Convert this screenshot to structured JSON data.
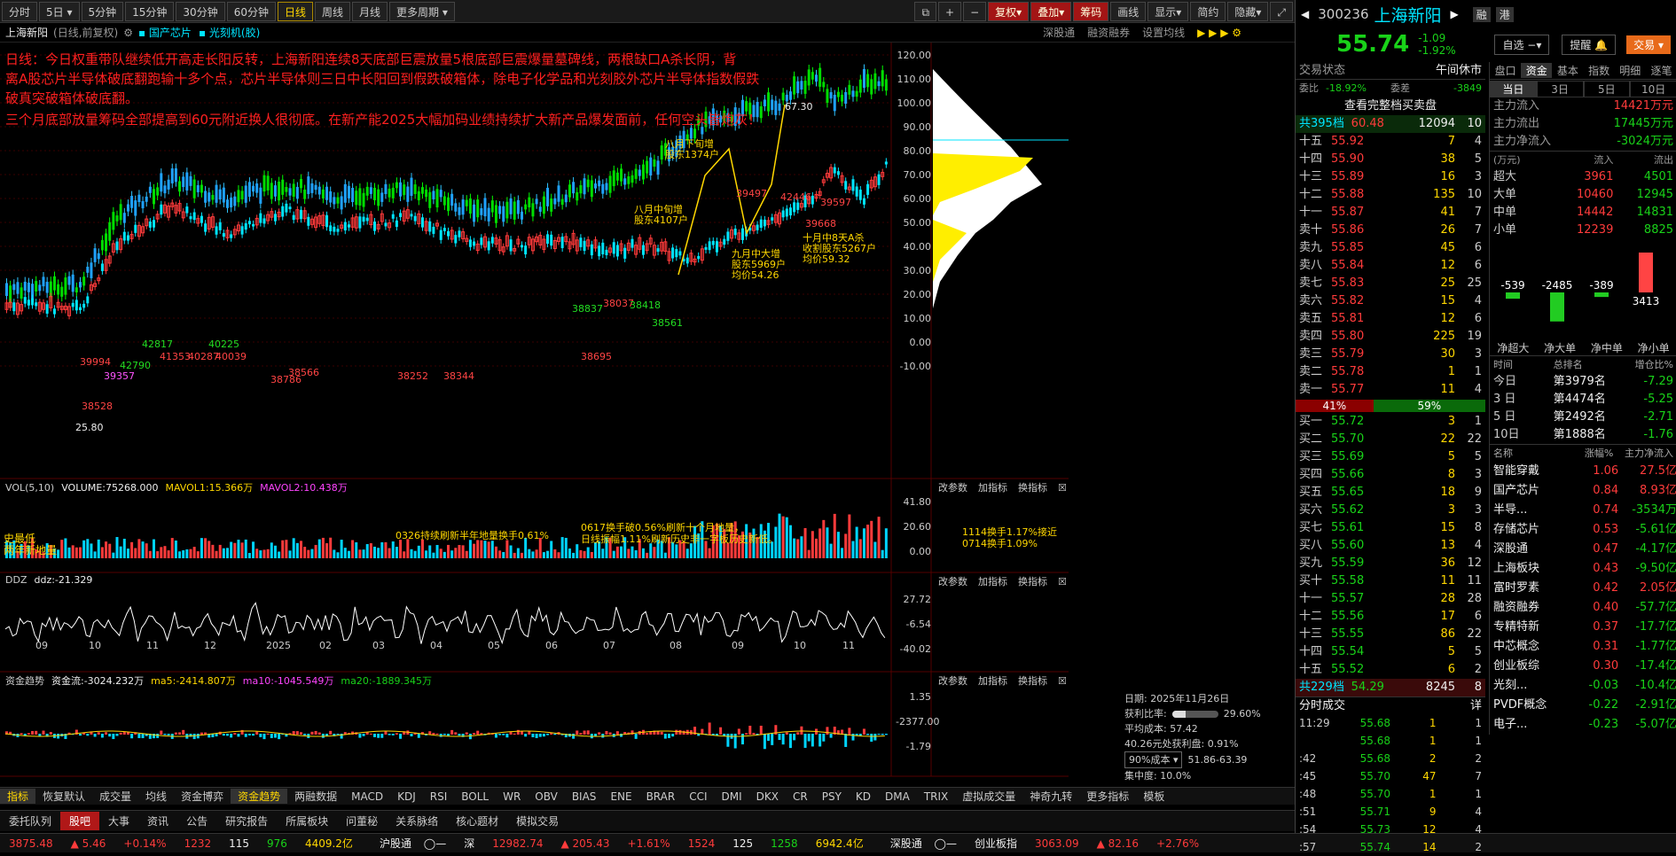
{
  "toolbar": {
    "items": [
      "分时",
      "5日",
      "5分钟",
      "15分钟",
      "30分钟",
      "60分钟",
      "日线",
      "周线",
      "月线",
      "更多周期"
    ],
    "active": "日线",
    "right": [
      "复权",
      "叠加",
      "筹码",
      "画线",
      "显示",
      "简约",
      "隐藏"
    ]
  },
  "subbar": {
    "title": "上海新阳",
    "mode": "(日线,前复权)",
    "concepts": [
      "国产芯片",
      "光刻机(胶)"
    ],
    "links": [
      "深股通",
      "融资融券",
      "设置均线"
    ]
  },
  "annotation_lines": [
    "日线：今日权重带队继续低开高走长阳反转，上海新阳连续8天底部巨震放量5根底部巨震爆量墓碑线，两根缺口A杀长阴，背",
    "离A股芯片半导体破底翻跑输十多个点，芯片半导体则三日中长阳回到假跌破箱体，除电子化学品和光刻胶外芯片半导体指数假跌",
    "破真突破箱体破底翻。",
    "三个月底部放量筹码全部提高到60元附近换人很彻底。在新产能2025大幅加码业绩持续扩大新产品爆发面前，任何空头皆炮灰！"
  ],
  "price_axis": [
    "120.00",
    "110.00",
    "100.00",
    "90.00",
    "80.00",
    "70.00",
    "60.00",
    "50.00",
    "40.00",
    "30.00",
    "20.00",
    "10.00",
    "0.00",
    "-10.00"
  ],
  "x_axis": [
    "09",
    "10",
    "11",
    "12",
    "2025",
    "02",
    "03",
    "04",
    "05",
    "06",
    "07",
    "08",
    "09",
    "10",
    "11"
  ],
  "chart_labels": [
    {
      "t": "67.30",
      "c": "wht"
    },
    {
      "t": "25.80",
      "c": "wht"
    },
    {
      "t": "八月下旬增",
      "c": "yel"
    },
    {
      "t": "股东1374户",
      "c": "yel"
    },
    {
      "t": "八月中旬增",
      "c": "yel"
    },
    {
      "t": "股东4107户",
      "c": "yel"
    },
    {
      "t": "九月中大增",
      "c": "yel"
    },
    {
      "t": "股东5969户",
      "c": "yel"
    },
    {
      "t": "均价54.26",
      "c": "yel"
    },
    {
      "t": "十月中8天A杀",
      "c": "yel"
    },
    {
      "t": "收割股东5267户",
      "c": "yel"
    },
    {
      "t": "均价59.32",
      "c": "yel"
    },
    {
      "t": "39994",
      "c": "red"
    },
    {
      "t": "42790",
      "c": "grn"
    },
    {
      "t": "39357",
      "c": "mag"
    },
    {
      "t": "42817",
      "c": "grn"
    },
    {
      "t": "41353",
      "c": "red"
    },
    {
      "t": "40287",
      "c": "red"
    },
    {
      "t": "40225",
      "c": "grn"
    },
    {
      "t": "40039",
      "c": "red"
    },
    {
      "t": "38837",
      "c": "grn"
    },
    {
      "t": "38037",
      "c": "red"
    },
    {
      "t": "38418",
      "c": "grn"
    },
    {
      "t": "38561",
      "c": "grn"
    },
    {
      "t": "38695",
      "c": "red"
    },
    {
      "t": "39497",
      "c": "red"
    },
    {
      "t": "42446",
      "c": "red"
    },
    {
      "t": "39668",
      "c": "red"
    },
    {
      "t": "39597",
      "c": "red"
    },
    {
      "t": "38528",
      "c": "red"
    },
    {
      "t": "38786",
      "c": "red"
    },
    {
      "t": "38252",
      "c": "red"
    },
    {
      "t": "38344",
      "c": "red"
    },
    {
      "t": "38566",
      "c": "red"
    }
  ],
  "vol_panel": {
    "label": "VOL(5,10)",
    "volume": "VOLUME:75268.000",
    "mavol1": "MAVOL1:15.366万",
    "mavol2": "MAVOL2:10.438万",
    "axis": [
      "41.80",
      "20.60",
      "0.00"
    ],
    "notes": [
      "史最低",
      "两年新地量",
      "0326持续刷新半年地量换手0.61%",
      "0617换手破0.56%刷新十个月地量，",
      "日线振幅1.11%刷新历史非一字板历史新低。",
      "1114换手1.17%接近",
      "0714换手1.09%"
    ]
  },
  "ddz_panel": {
    "label": "DDZ",
    "value": "ddz:-21.329",
    "axis": [
      "27.72",
      "-6.54",
      "-40.02"
    ]
  },
  "fund_panel": {
    "label": "资金趋势",
    "flow": "资金流:-3024.232万",
    "ma5": "ma5:-2414.807万",
    "ma10": "ma10:-1045.549万",
    "ma20": "ma20:-1889.345万",
    "axis": [
      "1.35",
      "-2377.00",
      "-1.79"
    ]
  },
  "panel_buttons": [
    "改参数",
    "加指标",
    "换指标"
  ],
  "chip_info": {
    "date": "日期: 2025年11月26日",
    "ratio_label": "获利比率:",
    "ratio": "29.60%",
    "avg": "平均成本: 57.42",
    "pressure": "40.26元处获利盘: 0.91%",
    "cost_sel": "90%成本",
    "cost_range": "51.86-63.39",
    "conc": "集中度: 10.0%"
  },
  "indicator_tabs": [
    "指标",
    "恢复默认",
    "成交量",
    "均线",
    "资金博弈",
    "资金趋势",
    "两融数据",
    "MACD",
    "KDJ",
    "RSI",
    "BOLL",
    "WR",
    "OBV",
    "BIAS",
    "ENE",
    "BRAR",
    "CCI",
    "DMI",
    "DKX",
    "CR",
    "PSY",
    "KD",
    "DMA",
    "TRIX",
    "虚拟成交量",
    "神奇九转",
    "更多指标",
    "模板"
  ],
  "bottom_tabs": [
    "委托队列",
    "股吧",
    "大事",
    "资讯",
    "公告",
    "研究报告",
    "所属板块",
    "问董秘",
    "关系脉络",
    "核心题材",
    "模拟交易"
  ],
  "status": {
    "sh": "3875.48",
    "sh_ch": "▲ 5.46",
    "sh_pct": "+0.14%",
    "sh_up": "1232",
    "sh_flat": "115",
    "sh_dn": "976",
    "sh_amt": "4409.2亿",
    "hgt": "沪股通",
    "sz_label": "深",
    "sz": "12982.74",
    "sz_ch": "▲ 205.43",
    "sz_pct": "+1.61%",
    "sz_up": "1524",
    "sz_flat": "125",
    "sz_dn": "1258",
    "sz_amt": "6942.4亿",
    "sgt": "深股通",
    "cyb": "创业板指",
    "cyb_v": "3063.09",
    "cyb_ch": "▲ 82.16",
    "cyb_pct": "+2.76%"
  },
  "quote": {
    "code": "300236",
    "name": "上海新阳",
    "tags": [
      "融",
      "港"
    ],
    "price": "55.74",
    "change": "-1.09",
    "pct": "-1.92%",
    "watch": "自选",
    "alert": "提醒",
    "trade": "交易",
    "state_label": "交易状态",
    "state": "午间休市",
    "weibi_label": "委比",
    "weibi": "-18.92%",
    "weicha_label": "委差",
    "weicha": "-3849",
    "view_full": "查看完整档买卖盘",
    "sell_total": {
      "label": "共395档",
      "price": "60.48",
      "vol": "12094",
      "cnt": "10"
    },
    "asks": [
      [
        "十五",
        "55.92",
        "7",
        "4"
      ],
      [
        "十四",
        "55.90",
        "38",
        "5"
      ],
      [
        "十三",
        "55.89",
        "16",
        "3"
      ],
      [
        "十二",
        "55.88",
        "135",
        "10"
      ],
      [
        "十一",
        "55.87",
        "41",
        "7"
      ],
      [
        "卖十",
        "55.86",
        "26",
        "7"
      ],
      [
        "卖九",
        "55.85",
        "45",
        "6"
      ],
      [
        "卖八",
        "55.84",
        "12",
        "6"
      ],
      [
        "卖七",
        "55.83",
        "25",
        "25"
      ],
      [
        "卖六",
        "55.82",
        "15",
        "4"
      ],
      [
        "卖五",
        "55.81",
        "12",
        "6"
      ],
      [
        "卖四",
        "55.80",
        "225",
        "19"
      ],
      [
        "卖三",
        "55.79",
        "30",
        "3"
      ],
      [
        "卖二",
        "55.78",
        "1",
        "1"
      ],
      [
        "卖一",
        "55.77",
        "11",
        "4"
      ]
    ],
    "bar_left": "41%",
    "bar_right": "59%",
    "bids": [
      [
        "买一",
        "55.72",
        "3",
        "1"
      ],
      [
        "买二",
        "55.70",
        "22",
        "22"
      ],
      [
        "买三",
        "55.69",
        "5",
        "5"
      ],
      [
        "买四",
        "55.66",
        "8",
        "3"
      ],
      [
        "买五",
        "55.65",
        "18",
        "9"
      ],
      [
        "买六",
        "55.62",
        "3",
        "3"
      ],
      [
        "买七",
        "55.61",
        "15",
        "8"
      ],
      [
        "买八",
        "55.60",
        "13",
        "4"
      ],
      [
        "买九",
        "55.59",
        "36",
        "12"
      ],
      [
        "买十",
        "55.58",
        "11",
        "11"
      ],
      [
        "十一",
        "55.57",
        "28",
        "28"
      ],
      [
        "十二",
        "55.56",
        "17",
        "6"
      ],
      [
        "十三",
        "55.55",
        "86",
        "22"
      ],
      [
        "十四",
        "55.54",
        "5",
        "5"
      ],
      [
        "十五",
        "55.52",
        "6",
        "2"
      ]
    ],
    "buy_total": {
      "label": "共229档",
      "price": "54.29",
      "vol": "8245",
      "cnt": "8"
    },
    "trades_label": "分时成交",
    "trades_more": "详",
    "trades": [
      [
        "11:29",
        "55.68",
        "1",
        "1"
      ],
      [
        "",
        "55.68",
        "1",
        "1"
      ],
      [
        ":42",
        "55.68",
        "2",
        "2"
      ],
      [
        ":45",
        "55.70",
        "47",
        "7"
      ],
      [
        ":48",
        "55.70",
        "1",
        "1"
      ],
      [
        ":51",
        "55.71",
        "9",
        "4"
      ],
      [
        ":54",
        "55.73",
        "12",
        "4"
      ],
      [
        ":57",
        "55.74",
        "14",
        "2"
      ]
    ]
  },
  "fund": {
    "tabs": [
      "盘口",
      "资金",
      "基本",
      "指数",
      "明细",
      "逐笔"
    ],
    "periods": [
      "当日",
      "3日",
      "5日",
      "10日"
    ],
    "main_in_label": "主力流入",
    "main_in": "14421万元",
    "main_out_label": "主力流出",
    "main_out": "17445万元",
    "main_net_label": "主力净流入",
    "main_net": "-3024万元",
    "unit": "(万元)",
    "in": "流入",
    "out": "流出",
    "rows": [
      [
        "超大",
        "3961",
        "4501"
      ],
      [
        "大单",
        "10460",
        "12945"
      ],
      [
        "中单",
        "14442",
        "14831"
      ],
      [
        "小单",
        "12239",
        "8825"
      ]
    ],
    "bars": [
      {
        "label": "净超大",
        "v": "-539"
      },
      {
        "label": "净大单",
        "v": "-2485"
      },
      {
        "label": "净中单",
        "v": "-389"
      },
      {
        "label": "净小单",
        "v": "3413"
      }
    ],
    "rank_hdr": [
      "时间",
      "总排名",
      "增仓比%"
    ],
    "ranks": [
      [
        "今日",
        "第3979名",
        "-7.29"
      ],
      [
        "3 日",
        "第4474名",
        "-5.25"
      ],
      [
        "5 日",
        "第2492名",
        "-2.71"
      ],
      [
        "10日",
        "第1888名",
        "-1.76"
      ]
    ],
    "sector_hdr": [
      "名称",
      "涨幅%",
      "主力净流入"
    ],
    "sectors": [
      [
        "智能穿戴",
        "1.06",
        "27.5亿"
      ],
      [
        "国产芯片",
        "0.84",
        "8.93亿"
      ],
      [
        "半导...",
        "0.74",
        "-3534万"
      ],
      [
        "存储芯片",
        "0.53",
        "-5.61亿"
      ],
      [
        "深股通",
        "0.47",
        "-4.17亿"
      ],
      [
        "上海板块",
        "0.43",
        "-9.50亿"
      ],
      [
        "富时罗素",
        "0.42",
        "2.05亿"
      ],
      [
        "融资融券",
        "0.40",
        "-57.7亿"
      ],
      [
        "专精特新",
        "0.37",
        "-17.7亿"
      ],
      [
        "中芯概念",
        "0.31",
        "-1.77亿"
      ],
      [
        "创业板综",
        "0.30",
        "-17.4亿"
      ],
      [
        "光刻...",
        "-0.03",
        "-10.4亿"
      ],
      [
        "PVDF概念",
        "-0.22",
        "-2.91亿"
      ],
      [
        "电子...",
        "-0.23",
        "-5.07亿"
      ]
    ]
  }
}
